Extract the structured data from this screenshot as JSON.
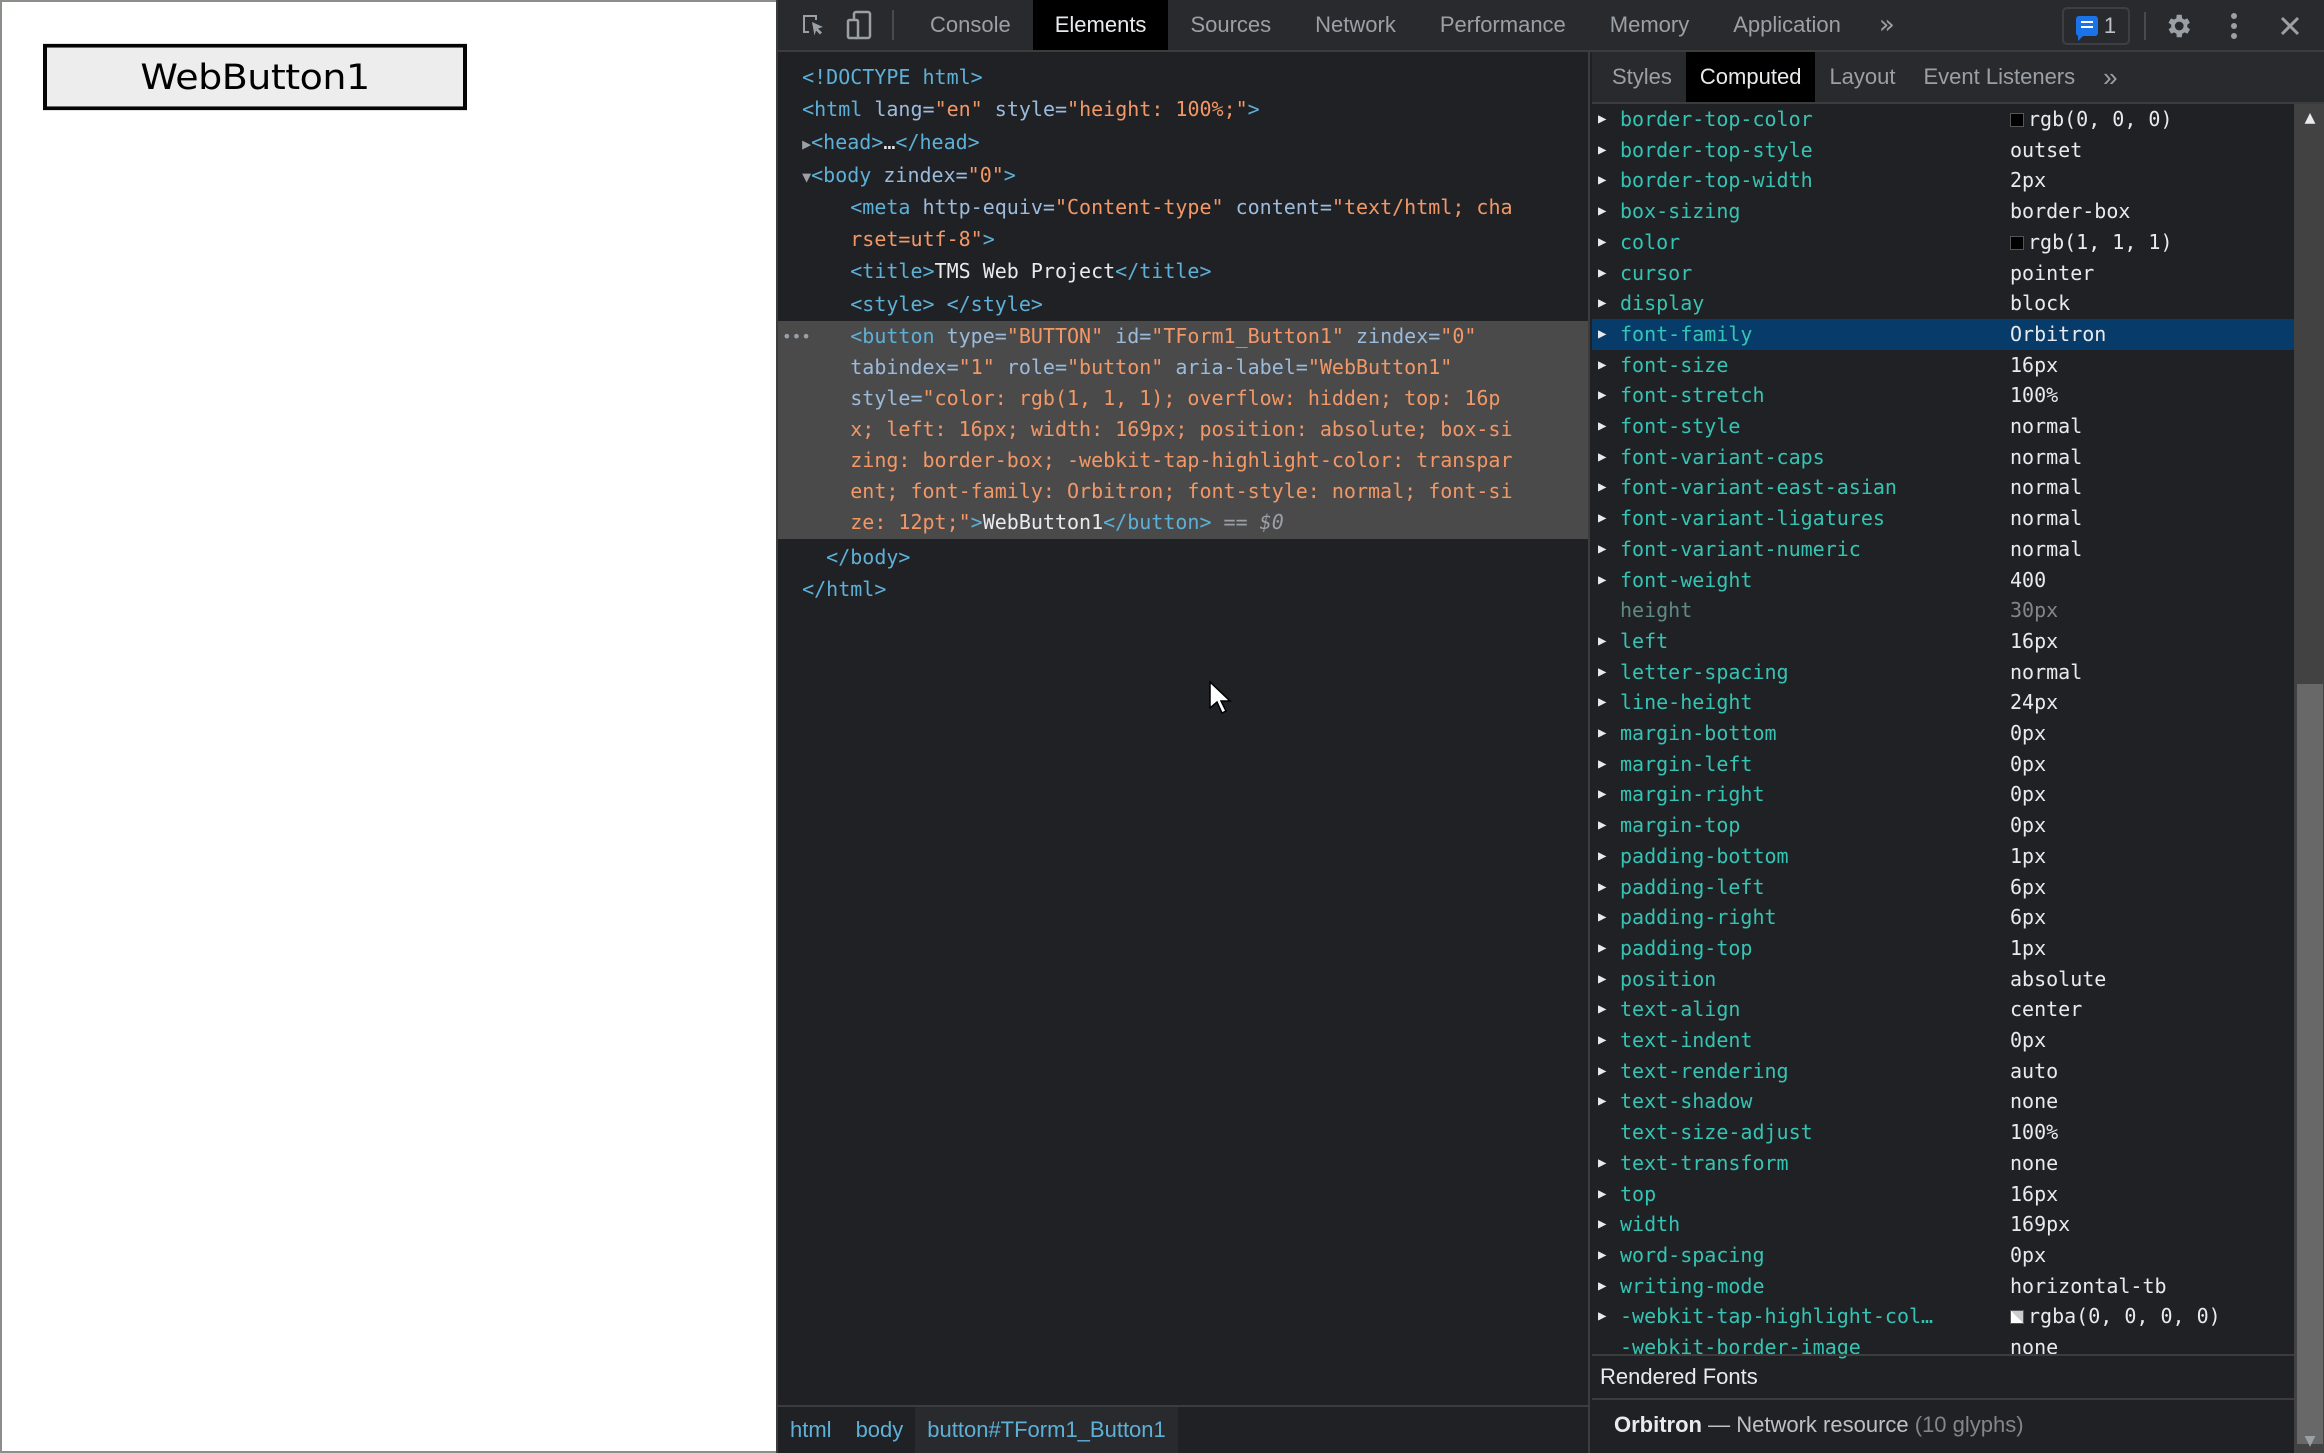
{
  "page": {
    "button_label": "WebButton1"
  },
  "devtools": {
    "main_tabs": [
      {
        "label": "Console",
        "active": false
      },
      {
        "label": "Elements",
        "active": true
      },
      {
        "label": "Sources",
        "active": false
      },
      {
        "label": "Network",
        "active": false
      },
      {
        "label": "Performance",
        "active": false
      },
      {
        "label": "Memory",
        "active": false
      },
      {
        "label": "Application",
        "active": false
      }
    ],
    "more_tabs_label": "»",
    "issues_count": "1",
    "icons": {
      "inspect": "inspect-element-icon",
      "device": "device-toolbar-icon",
      "issues": "message-icon",
      "settings": "gear-icon",
      "more": "kebab-menu-icon",
      "close": "close-icon"
    },
    "elements_tree": {
      "doctype": "<!DOCTYPE html>",
      "html_open": {
        "tag": "<html",
        "attr1": " lang=",
        "val1": "\"en\"",
        "attr2": " style=",
        "val2": "\"height: 100%;\"",
        "end": ">"
      },
      "head": {
        "open": "<head>",
        "ellipsis": "…",
        "close": "</head>"
      },
      "body_open": {
        "tag": "<body",
        "attr": " zindex=",
        "val": "\"0\"",
        "end": ">"
      },
      "meta_line1": {
        "tag": "<meta",
        "attr1": " http-equiv=",
        "val1": "\"Content-type\"",
        "attr2": " content=",
        "val2": "\"text/html; cha"
      },
      "meta_line2": {
        "val": "rset=utf-8\"",
        "end": ">"
      },
      "title": {
        "open": "<title>",
        "text": "TMS Web Project",
        "close": "</title>"
      },
      "style": {
        "text": "<style> </style>"
      },
      "button_lines": [
        {
          "tag": "<button",
          "attr1": " type=",
          "val1": "\"BUTTON\"",
          "attr2": " id=",
          "val2": "\"TForm1_Button1\"",
          "attr3": " zindex=",
          "val3": "\"0\""
        },
        {
          "attr1": "tabindex=",
          "val1": "\"1\"",
          "attr2": " role=",
          "val2": "\"button\"",
          "attr3": " aria-label=",
          "val3": "\"WebButton1\""
        },
        {
          "attr1": "style=",
          "val1": "\"color: rgb(1, 1, 1); overflow: hidden; top: 16p"
        },
        {
          "val1": "x; left: 16px; width: 169px; position: absolute; box-si"
        },
        {
          "val1": "zing: border-box; -webkit-tap-highlight-color: transpar"
        },
        {
          "val1": "ent; font-family: Orbitron; font-style: normal; font-si"
        },
        {
          "val1": "ze: 12pt;\"",
          "end": ">",
          "text": "WebButton1",
          "close": "</button>",
          "suffix": " == $0"
        }
      ],
      "body_close": "</body>",
      "html_close": "</html>"
    },
    "breadcrumbs": [
      {
        "label": "html",
        "active": false
      },
      {
        "label": "body",
        "active": false
      },
      {
        "label": "button#TForm1_Button1",
        "active": true
      }
    ],
    "side_tabs": [
      {
        "label": "Styles",
        "active": false
      },
      {
        "label": "Computed",
        "active": true
      },
      {
        "label": "Layout",
        "active": false
      },
      {
        "label": "Event Listeners",
        "active": false
      }
    ],
    "computed_properties": [
      {
        "name": "border-top-color",
        "value": "rgb(0, 0, 0)",
        "swatch": "#000000",
        "expandable": true
      },
      {
        "name": "border-top-style",
        "value": "outset",
        "expandable": true
      },
      {
        "name": "border-top-width",
        "value": "2px",
        "expandable": true
      },
      {
        "name": "box-sizing",
        "value": "border-box",
        "expandable": true
      },
      {
        "name": "color",
        "value": "rgb(1, 1, 1)",
        "swatch": "#010101",
        "expandable": true
      },
      {
        "name": "cursor",
        "value": "pointer",
        "expandable": true
      },
      {
        "name": "display",
        "value": "block",
        "expandable": true
      },
      {
        "name": "font-family",
        "value": "Orbitron",
        "expandable": true,
        "selected": true
      },
      {
        "name": "font-size",
        "value": "16px",
        "expandable": true
      },
      {
        "name": "font-stretch",
        "value": "100%",
        "expandable": true
      },
      {
        "name": "font-style",
        "value": "normal",
        "expandable": true
      },
      {
        "name": "font-variant-caps",
        "value": "normal",
        "expandable": true
      },
      {
        "name": "font-variant-east-asian",
        "value": "normal",
        "expandable": true
      },
      {
        "name": "font-variant-ligatures",
        "value": "normal",
        "expandable": true
      },
      {
        "name": "font-variant-numeric",
        "value": "normal",
        "expandable": true
      },
      {
        "name": "font-weight",
        "value": "400",
        "expandable": true
      },
      {
        "name": "height",
        "value": "30px",
        "expandable": false,
        "inherited": true
      },
      {
        "name": "left",
        "value": "16px",
        "expandable": true
      },
      {
        "name": "letter-spacing",
        "value": "normal",
        "expandable": true
      },
      {
        "name": "line-height",
        "value": "24px",
        "expandable": true
      },
      {
        "name": "margin-bottom",
        "value": "0px",
        "expandable": true
      },
      {
        "name": "margin-left",
        "value": "0px",
        "expandable": true
      },
      {
        "name": "margin-right",
        "value": "0px",
        "expandable": true
      },
      {
        "name": "margin-top",
        "value": "0px",
        "expandable": true
      },
      {
        "name": "padding-bottom",
        "value": "1px",
        "expandable": true
      },
      {
        "name": "padding-left",
        "value": "6px",
        "expandable": true
      },
      {
        "name": "padding-right",
        "value": "6px",
        "expandable": true
      },
      {
        "name": "padding-top",
        "value": "1px",
        "expandable": true
      },
      {
        "name": "position",
        "value": "absolute",
        "expandable": true
      },
      {
        "name": "text-align",
        "value": "center",
        "expandable": true
      },
      {
        "name": "text-indent",
        "value": "0px",
        "expandable": true
      },
      {
        "name": "text-rendering",
        "value": "auto",
        "expandable": true
      },
      {
        "name": "text-shadow",
        "value": "none",
        "expandable": true
      },
      {
        "name": "text-size-adjust",
        "value": "100%",
        "expandable": false
      },
      {
        "name": "text-transform",
        "value": "none",
        "expandable": true
      },
      {
        "name": "top",
        "value": "16px",
        "expandable": true
      },
      {
        "name": "width",
        "value": "169px",
        "expandable": true
      },
      {
        "name": "word-spacing",
        "value": "0px",
        "expandable": true
      },
      {
        "name": "writing-mode",
        "value": "horizontal-tb",
        "expandable": true
      },
      {
        "name": "-webkit-tap-highlight-col…",
        "value": "rgba(0, 0, 0, 0)",
        "swatch": "transparent",
        "expandable": true
      },
      {
        "name": "-webkit-border-image",
        "value": "none",
        "expandable": false
      }
    ],
    "rendered_fonts": {
      "header": "Rendered Fonts",
      "font_name": "Orbitron",
      "separator": " — ",
      "source": "Network resource",
      "glyphs": "(10 glyphs)"
    }
  },
  "colors": {
    "selection_blue": "#073b6a",
    "prop_name_teal": "#35c4b4",
    "tag_blue": "#5db0d7",
    "attr_value_orange": "#f29766",
    "issues_blue": "#1a73e8"
  }
}
